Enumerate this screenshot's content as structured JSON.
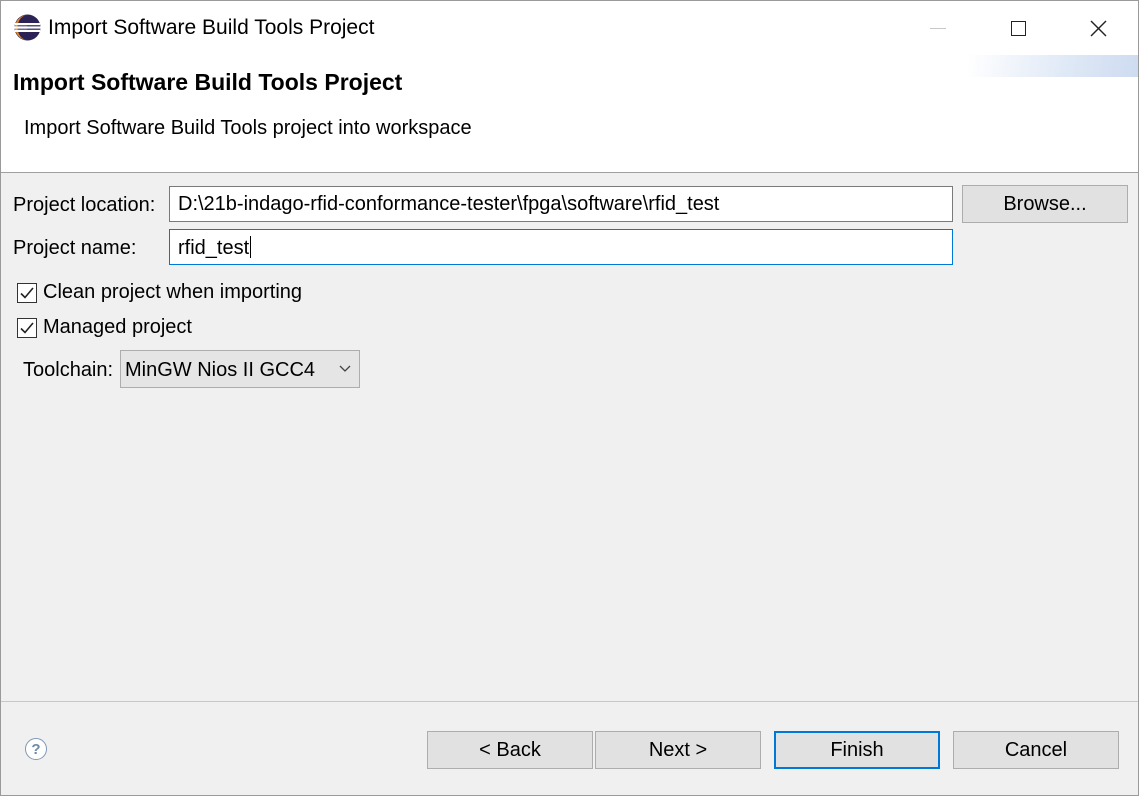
{
  "window": {
    "title": "Import Software Build Tools Project",
    "controls": {
      "minimize": "minimize-icon",
      "maximize": "maximize-icon",
      "close": "close-icon"
    }
  },
  "header": {
    "title": "Import Software Build Tools Project",
    "description": "Import Software Build Tools project into workspace"
  },
  "form": {
    "project_location_label": "Project location:",
    "project_location_value": "D:\\21b-indago-rfid-conformance-tester\\fpga\\software\\rfid_test",
    "browse_label": "Browse...",
    "project_name_label": "Project name:",
    "project_name_value": "rfid_test",
    "clean_project_label": "Clean project when importing",
    "clean_project_checked": true,
    "managed_project_label": "Managed project",
    "managed_project_checked": true,
    "toolchain_label": "Toolchain:",
    "toolchain_value": "MinGW Nios II GCC4"
  },
  "footer": {
    "help_icon": "?",
    "back_label": "< Back",
    "next_label": "Next >",
    "finish_label": "Finish",
    "cancel_label": "Cancel"
  },
  "colors": {
    "focus_blue": "#0078d7",
    "dialog_bg": "#f0f0f0",
    "button_bg": "#e1e1e1"
  }
}
